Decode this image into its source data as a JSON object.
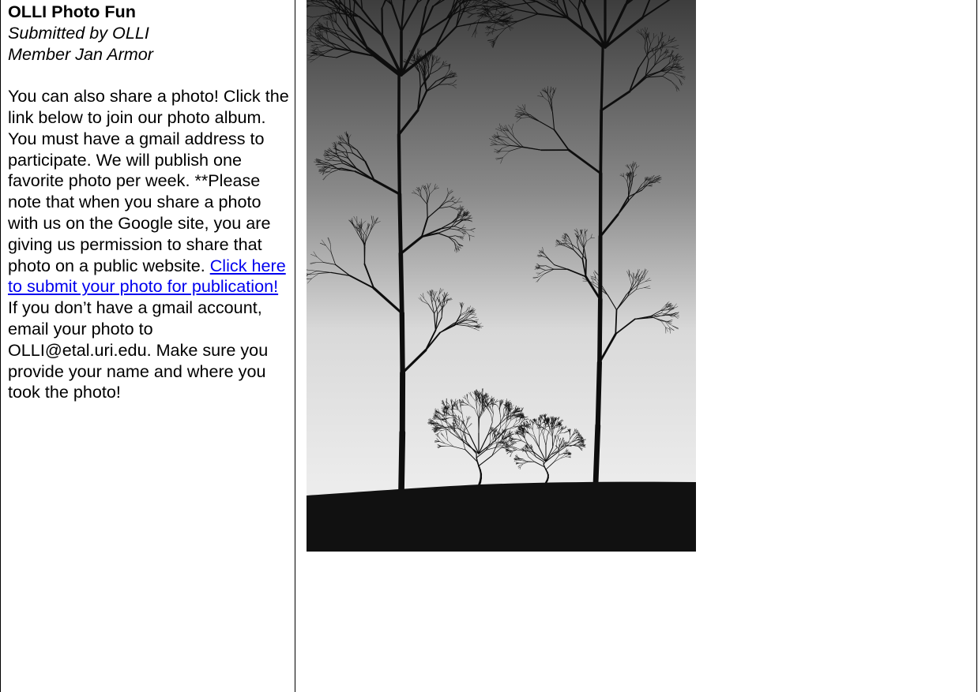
{
  "article": {
    "title": "OLLI Photo Fun",
    "byline": "Submitted by OLLI Member Jan Armor",
    "body_before_link": "You can also share a photo! Click the link below to join our photo album. You must have a gmail address to participate. We will publish one favorite photo per week. **Please note that when you share a photo with us on the Google site, you are giving us permission to share that photo on a public website. ",
    "link_text": "Click here to submit your photo for publication! ",
    "body_after_link": "If you don’t have a gmail account, email your photo to OLLI@etal.uri.edu. Make sure you provide your name and where you took the photo!"
  },
  "photo": {
    "icon": "tree-photo-icon",
    "colors": {
      "sky_top": "#3d3d3d",
      "sky_mid": "#d9d9d9",
      "sky_low": "#ececec",
      "ground": "#111111"
    }
  }
}
